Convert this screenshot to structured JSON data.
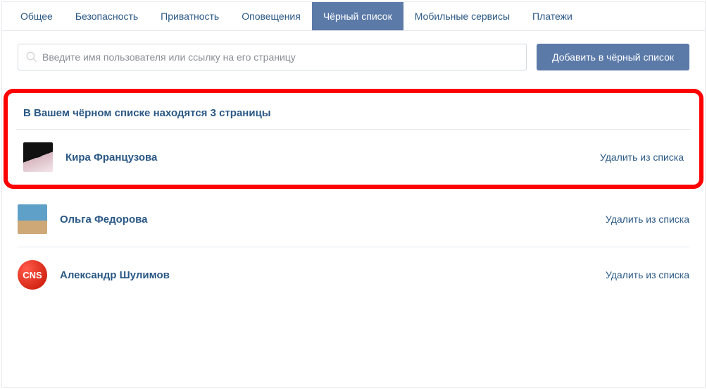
{
  "tabs": [
    {
      "label": "Общее",
      "active": false
    },
    {
      "label": "Безопасность",
      "active": false
    },
    {
      "label": "Приватность",
      "active": false
    },
    {
      "label": "Оповещения",
      "active": false
    },
    {
      "label": "Чёрный список",
      "active": true
    },
    {
      "label": "Мобильные сервисы",
      "active": false
    },
    {
      "label": "Платежи",
      "active": false
    }
  ],
  "search": {
    "placeholder": "Введите имя пользователя или ссылку на его страницу"
  },
  "add_button": "Добавить в чёрный список",
  "list_header": "В Вашем чёрном списке находятся 3 страницы",
  "remove_label": "Удалить из списка",
  "entries": [
    {
      "name": "Кира Французова",
      "avatar_class": "kira",
      "avatar_text": ""
    },
    {
      "name": "Ольга Федорова",
      "avatar_class": "olga",
      "avatar_text": ""
    },
    {
      "name": "Александр Шулимов",
      "avatar_class": "cns",
      "avatar_text": "CNS"
    }
  ]
}
